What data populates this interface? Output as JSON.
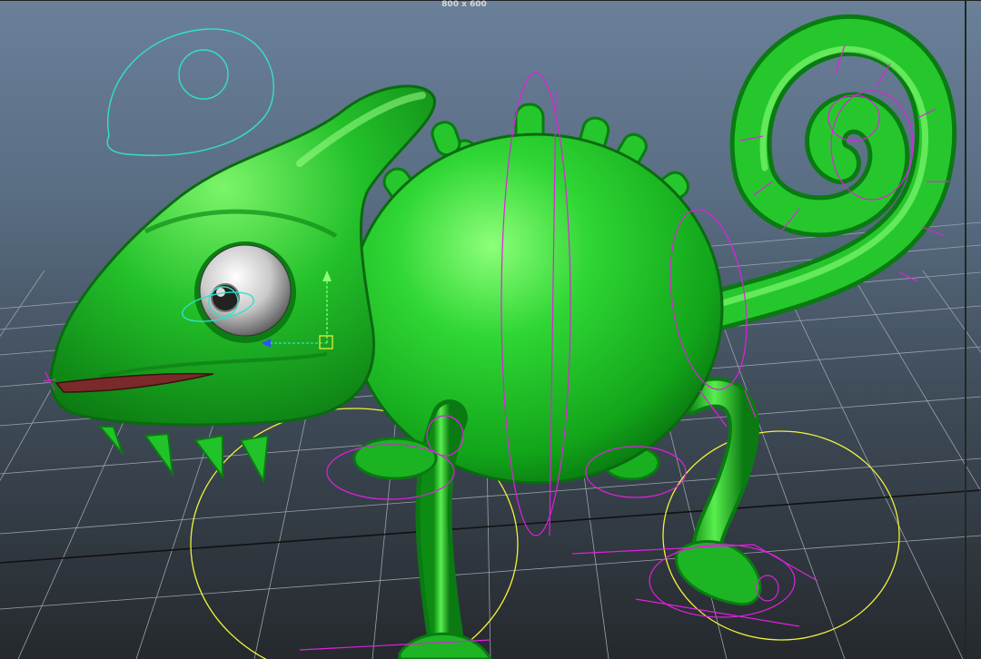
{
  "viewport": {
    "resolution_gate_label": "800 x 600",
    "subject": "chameleon-character-rig",
    "colors": {
      "background_top": "#6a8099",
      "background_bottom": "#25292d",
      "grid": "#9aa3ab",
      "grid_axis": "#111111",
      "body": "#22c22a",
      "body_highlight": "#7dff6a",
      "body_shadow": "#0b6f12",
      "eye_white": "#e6e6e6",
      "control_magenta": "#e020e0",
      "control_cyan": "#33e0c8",
      "control_yellow": "#f2f23a",
      "mouth": "#7a2a2a"
    }
  }
}
